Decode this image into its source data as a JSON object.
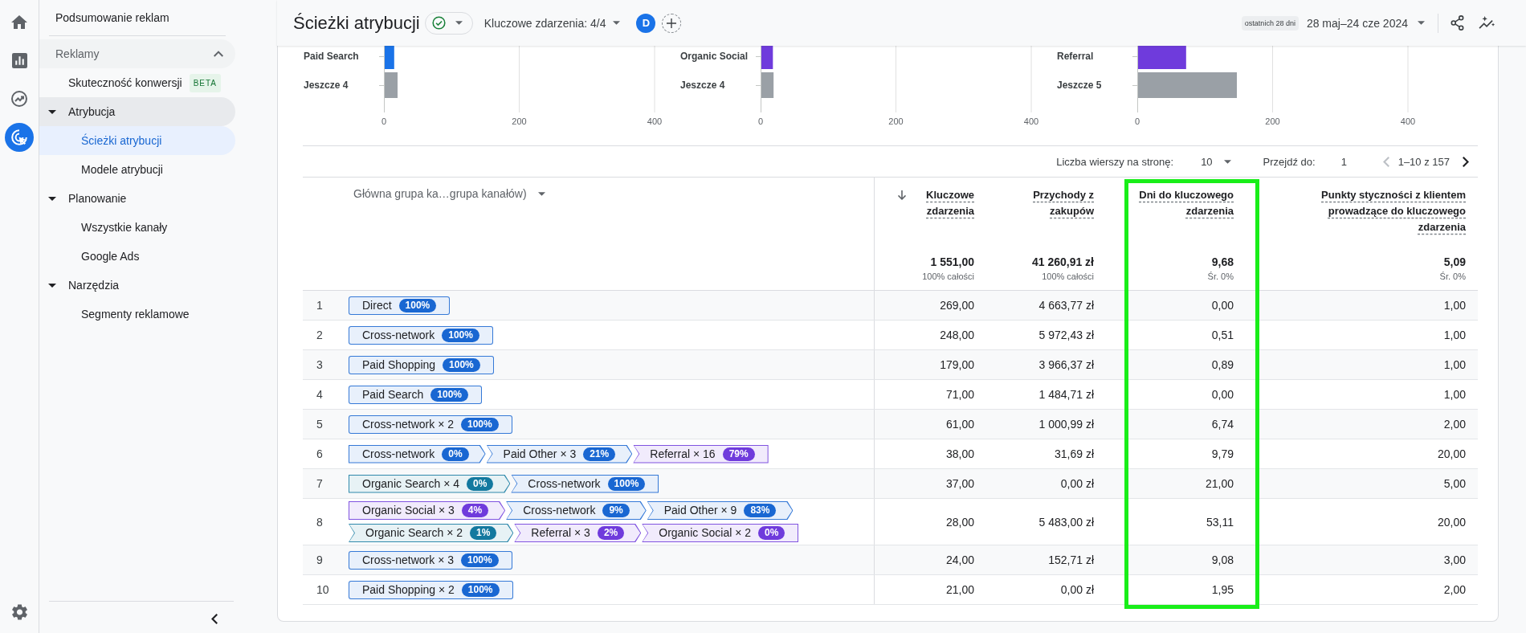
{
  "rail": {
    "items": [
      {
        "selected": false
      },
      {
        "selected": false
      },
      {
        "selected": false
      },
      {
        "selected": true
      }
    ]
  },
  "sidebar": {
    "title": "Podsumowanie reklam",
    "section": {
      "label": "Reklamy",
      "expanded": true
    },
    "items": [
      {
        "kind": "link",
        "label": "Skuteczność konwersji",
        "badge": "BETA",
        "selected": false
      },
      {
        "kind": "group",
        "label": "Atrybucja",
        "expanded": true,
        "children": [
          {
            "label": "Ścieżki atrybucji",
            "selected": true
          },
          {
            "label": "Modele atrybucji",
            "selected": false
          }
        ]
      },
      {
        "kind": "group",
        "label": "Planowanie",
        "expanded": true,
        "children": [
          {
            "label": "Wszystkie kanały",
            "selected": false
          },
          {
            "label": "Google Ads",
            "selected": false
          }
        ]
      },
      {
        "kind": "group",
        "label": "Narzędzia",
        "expanded": true,
        "children": [
          {
            "label": "Segmenty reklamowe",
            "selected": false
          }
        ]
      }
    ]
  },
  "header": {
    "title": "Ścieżki atrybucji",
    "key_events": "Kluczowe zdarzenia: 4/4",
    "comparisons": [
      {
        "label": "D"
      }
    ],
    "date_preset": "ostatnich 28 dni",
    "date_range": "28 maj–24 cze 2024"
  },
  "charts": [
    {
      "chart_data": {
        "type": "bar",
        "orientation": "horizontal",
        "categories": [
          "Paid Search",
          "Jeszcze 4"
        ],
        "values": [
          14,
          19
        ],
        "colors": [
          "#1a73e8",
          "#9aa0a6"
        ],
        "xlim": [
          0,
          400
        ],
        "xticks": [
          0,
          200,
          400
        ]
      }
    },
    {
      "chart_data": {
        "type": "bar",
        "orientation": "horizontal",
        "categories": [
          "Organic Social",
          "Jeszcze 4"
        ],
        "values": [
          17,
          18
        ],
        "colors": [
          "#6f3bdc",
          "#9aa0a6"
        ],
        "xlim": [
          0,
          400
        ],
        "xticks": [
          0,
          200,
          400
        ]
      }
    },
    {
      "chart_data": {
        "type": "bar",
        "orientation": "horizontal",
        "categories": [
          "Referral",
          "Jeszcze 5"
        ],
        "values": [
          71,
          146
        ],
        "colors": [
          "#6f3bdc",
          "#9aa0a6"
        ],
        "xlim": [
          0,
          400
        ],
        "xticks": [
          0,
          200,
          400
        ]
      }
    }
  ],
  "pagination": {
    "rows_label": "Liczba wierszy na stronę:",
    "rows_per_page": "10",
    "goto_label": "Przejdź do:",
    "page": "1",
    "range": "1–10 z 157",
    "prev_disabled": true,
    "next_disabled": false
  },
  "table": {
    "dimension_header": "Główna grupa ka…grupa kanałów)",
    "columns": [
      {
        "label": "Kluczowe zdarzenia",
        "sorted": true,
        "highlighted": false,
        "total": "1 551,00",
        "total_note": "100% całości"
      },
      {
        "label": "Przychody z zakupów",
        "sorted": false,
        "highlighted": false,
        "total": "41 260,91 zł",
        "total_note": "100% całości"
      },
      {
        "label": "Dni do kluczowego zdarzenia",
        "sorted": false,
        "highlighted": true,
        "total": "9,68",
        "total_note": "Śr. 0%"
      },
      {
        "label": "Punkty styczności z klientem prowadzące do kluczowego zdarzenia",
        "sorted": false,
        "highlighted": false,
        "total": "5,09",
        "total_note": "Śr. 0%"
      }
    ],
    "rows": [
      {
        "number": "1",
        "path": [
          {
            "label": "Direct",
            "share": "100%",
            "color": "#1967d2"
          }
        ],
        "values": [
          "269,00",
          "4 663,77 zł",
          "0,00",
          "1,00"
        ]
      },
      {
        "number": "2",
        "path": [
          {
            "label": "Cross-network",
            "share": "100%",
            "color": "#1967d2"
          }
        ],
        "values": [
          "248,00",
          "5 972,43 zł",
          "0,51",
          "1,00"
        ]
      },
      {
        "number": "3",
        "path": [
          {
            "label": "Paid Shopping",
            "share": "100%",
            "color": "#1967d2"
          }
        ],
        "values": [
          "179,00",
          "3 966,37 zł",
          "0,89",
          "1,00"
        ]
      },
      {
        "number": "4",
        "path": [
          {
            "label": "Paid Search",
            "share": "100%",
            "color": "#1967d2"
          }
        ],
        "values": [
          "71,00",
          "1 484,71 zł",
          "0,00",
          "1,00"
        ]
      },
      {
        "number": "5",
        "path": [
          {
            "label": "Cross-network × 2",
            "share": "100%",
            "color": "#1967d2"
          }
        ],
        "values": [
          "61,00",
          "1 000,99 zł",
          "6,74",
          "2,00"
        ]
      },
      {
        "number": "6",
        "path": [
          {
            "label": "Cross-network",
            "share": "0%",
            "color": "#1967d2"
          },
          {
            "label": "Paid Other × 3",
            "share": "21%",
            "color": "#1967d2"
          },
          {
            "label": "Referral × 16",
            "share": "79%",
            "color": "#6f3bdc"
          }
        ],
        "values": [
          "38,00",
          "31,69 zł",
          "9,79",
          "20,00"
        ]
      },
      {
        "number": "7",
        "path": [
          {
            "label": "Organic Search × 4",
            "share": "0%",
            "color": "#13799f"
          },
          {
            "label": "Cross-network",
            "share": "100%",
            "color": "#1967d2"
          }
        ],
        "values": [
          "37,00",
          "0,00 zł",
          "21,00",
          "5,00"
        ]
      },
      {
        "number": "8",
        "path": [
          {
            "label": "Organic Social × 3",
            "share": "4%",
            "color": "#6f3bdc"
          },
          {
            "label": "Cross-network",
            "share": "9%",
            "color": "#1967d2"
          },
          {
            "label": "Paid Other × 9",
            "share": "83%",
            "color": "#1967d2"
          },
          {
            "label": "Organic Search × 2",
            "share": "1%",
            "color": "#13799f"
          },
          {
            "label": "Referral × 3",
            "share": "2%",
            "color": "#6f3bdc"
          },
          {
            "label": "Organic Social × 2",
            "share": "0%",
            "color": "#6f3bdc"
          }
        ],
        "values": [
          "28,00",
          "5 483,00 zł",
          "53,11",
          "20,00"
        ]
      },
      {
        "number": "9",
        "path": [
          {
            "label": "Cross-network × 3",
            "share": "100%",
            "color": "#1967d2"
          }
        ],
        "values": [
          "24,00",
          "152,71 zł",
          "9,08",
          "3,00"
        ]
      },
      {
        "number": "10",
        "path": [
          {
            "label": "Paid Shopping × 2",
            "share": "100%",
            "color": "#1967d2"
          }
        ],
        "values": [
          "21,00",
          "0,00 zł",
          "1,95",
          "2,00"
        ]
      }
    ]
  }
}
